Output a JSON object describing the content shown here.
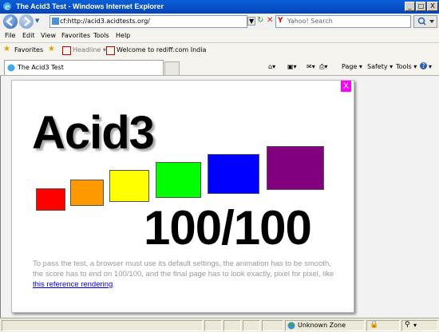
{
  "window": {
    "title": "The Acid3 Test - Windows Internet Explorer",
    "controls": [
      "_",
      "□",
      "X"
    ]
  },
  "address_bar": {
    "url": "cf:http://acid3.acidtests.org/",
    "refresh": "↻",
    "stop": "✕"
  },
  "search": {
    "placeholder": "Yahoo! Search"
  },
  "menu": {
    "items": [
      "File",
      "Edit",
      "View",
      "Favorites",
      "Tools",
      "Help"
    ]
  },
  "favorites_bar": {
    "favorites_label": "Favorites",
    "items": [
      "Headline ▾",
      "Welcome to rediff.com India"
    ]
  },
  "tabs": {
    "active_label": "The Acid3 Test"
  },
  "command_bar": {
    "page_label": "Page ▾",
    "safety_label": "Safety ▾",
    "tools_label": "Tools ▾",
    "help_label": "▾"
  },
  "content": {
    "close_label": "X",
    "title": "Acid3",
    "score": "100/100",
    "description_before": "To pass the test, a browser must use its default settings, the animation has to be smooth, the score has to end on 100/100, and the final page has to look exactly, pixel for pixel, like ",
    "description_link": "this reference rendering",
    "description_after": ".",
    "boxes": [
      {
        "color": "#ff0000"
      },
      {
        "color": "#ff9900"
      },
      {
        "color": "#ffff00"
      },
      {
        "color": "#00ff00"
      },
      {
        "color": "#0000ff"
      },
      {
        "color": "#800080"
      }
    ]
  },
  "status_bar": {
    "zone": "Unknown Zone",
    "zoom": "▾"
  }
}
